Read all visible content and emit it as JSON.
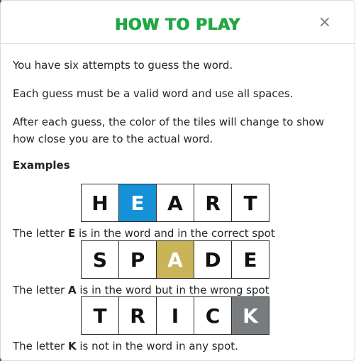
{
  "modal": {
    "title": "HOW TO PLAY",
    "close_label": "×",
    "paragraphs": [
      "You have six attempts to guess the word.",
      "Each guess must be a valid word and use all spaces.",
      "After each guess, the color of the tiles will change to show how close you are to the actual word."
    ],
    "examples_heading": "Examples",
    "examples": [
      {
        "tiles": [
          "H",
          "E",
          "A",
          "R",
          "T"
        ],
        "highlight_index": 1,
        "highlight_state": "correct",
        "desc_prefix": "The letter ",
        "desc_letter": "E",
        "desc_suffix": " is in the word and in the correct spot"
      },
      {
        "tiles": [
          "S",
          "P",
          "A",
          "D",
          "E"
        ],
        "highlight_index": 2,
        "highlight_state": "present",
        "desc_prefix": "The letter ",
        "desc_letter": "A",
        "desc_suffix": " is in the word but in the wrong spot"
      },
      {
        "tiles": [
          "T",
          "R",
          "I",
          "C",
          "K"
        ],
        "highlight_index": 4,
        "highlight_state": "absent",
        "desc_prefix": "The letter ",
        "desc_letter": "K",
        "desc_suffix": " is not in the word in any spot."
      }
    ]
  },
  "colors": {
    "title": "#22a745",
    "correct": "#1591d8",
    "present": "#c9b458",
    "absent": "#787c7e"
  }
}
